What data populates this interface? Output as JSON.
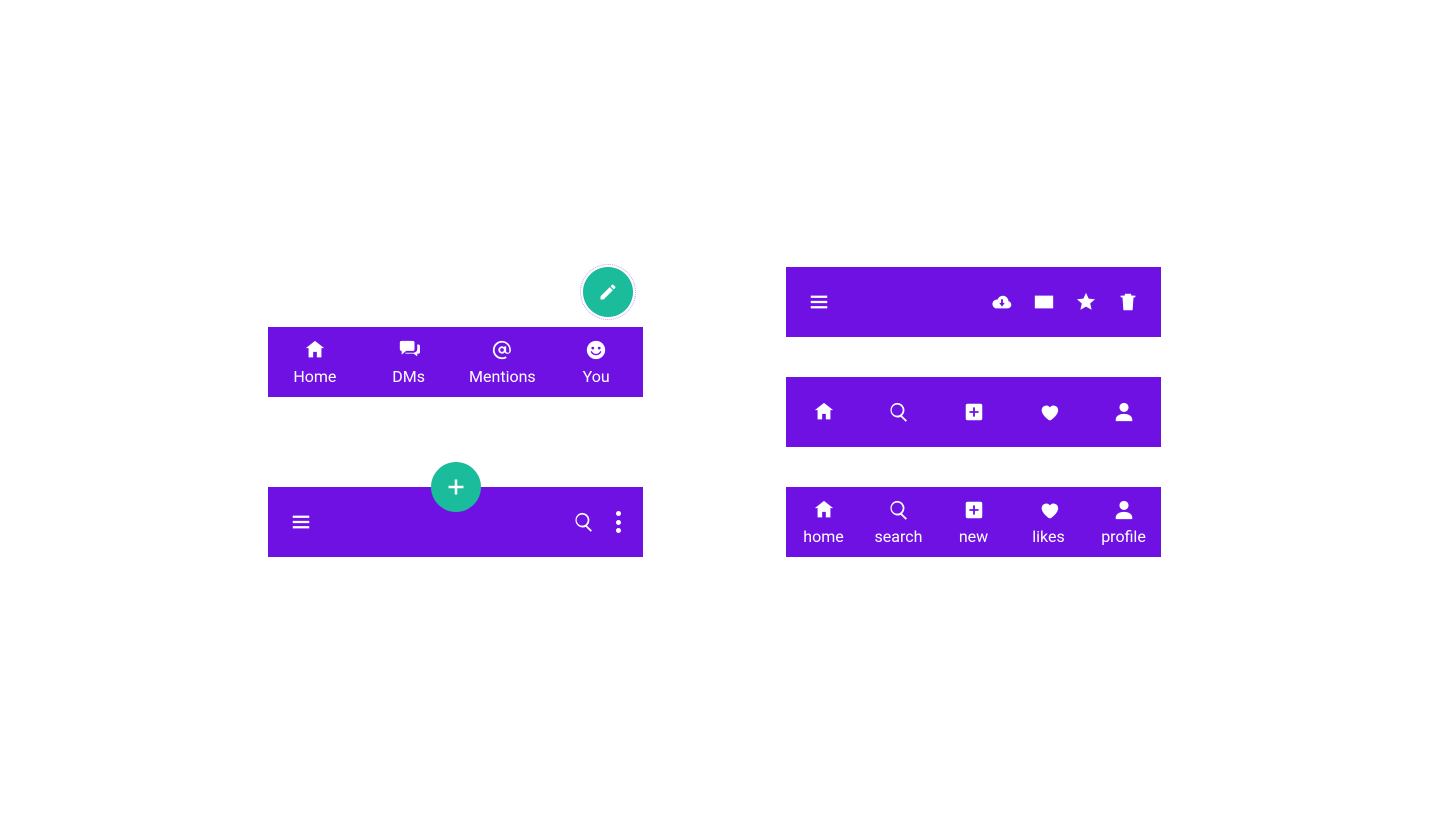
{
  "colors": {
    "primary": "#7011e4",
    "accent": "#1bbc9b"
  },
  "bar1": {
    "tabs": [
      {
        "label": "Home"
      },
      {
        "label": "DMs"
      },
      {
        "label": "Mentions"
      },
      {
        "label": "You"
      }
    ]
  },
  "bar5": {
    "tabs": [
      {
        "label": "home"
      },
      {
        "label": "search"
      },
      {
        "label": "new"
      },
      {
        "label": "likes"
      },
      {
        "label": "profile"
      }
    ]
  }
}
